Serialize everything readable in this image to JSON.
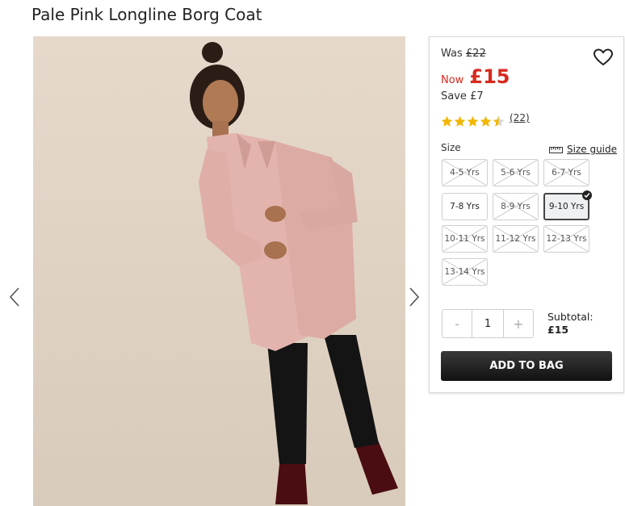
{
  "product": {
    "title": "Pale Pink Longline Borg Coat"
  },
  "pricing": {
    "was_label": "Was",
    "was_price": "£22",
    "now_label": "Now",
    "now_price": "£15",
    "save_label": "Save",
    "save_amount": "£7"
  },
  "rating": {
    "stars": 4.5,
    "review_count": "(22)"
  },
  "size": {
    "label": "Size",
    "guide_label": "Size guide",
    "options": [
      {
        "label": "4-5 Yrs",
        "available": false,
        "selected": false
      },
      {
        "label": "5-6 Yrs",
        "available": false,
        "selected": false
      },
      {
        "label": "6-7 Yrs",
        "available": false,
        "selected": false
      },
      {
        "label": "7-8 Yrs",
        "available": true,
        "selected": false
      },
      {
        "label": "8-9 Yrs",
        "available": false,
        "selected": false
      },
      {
        "label": "9-10 Yrs",
        "available": true,
        "selected": true
      },
      {
        "label": "10-11 Yrs",
        "available": false,
        "selected": false
      },
      {
        "label": "11-12 Yrs",
        "available": false,
        "selected": false
      },
      {
        "label": "12-13 Yrs",
        "available": false,
        "selected": false
      },
      {
        "label": "13-14 Yrs",
        "available": false,
        "selected": false
      }
    ]
  },
  "quantity": {
    "minus": "-",
    "value": "1",
    "plus": "+"
  },
  "subtotal": {
    "label": "Subtotal:",
    "amount": "£15"
  },
  "actions": {
    "add_to_bag": "ADD TO BAG"
  },
  "colors": {
    "price_red": "#d72a1f",
    "star_gold": "#f2b705",
    "button_dark": "#222222"
  },
  "icons": {
    "wishlist": "heart-icon",
    "prev": "chevron-left-icon",
    "next": "chevron-right-icon",
    "size_guide": "ruler-icon",
    "selected": "check-icon"
  }
}
